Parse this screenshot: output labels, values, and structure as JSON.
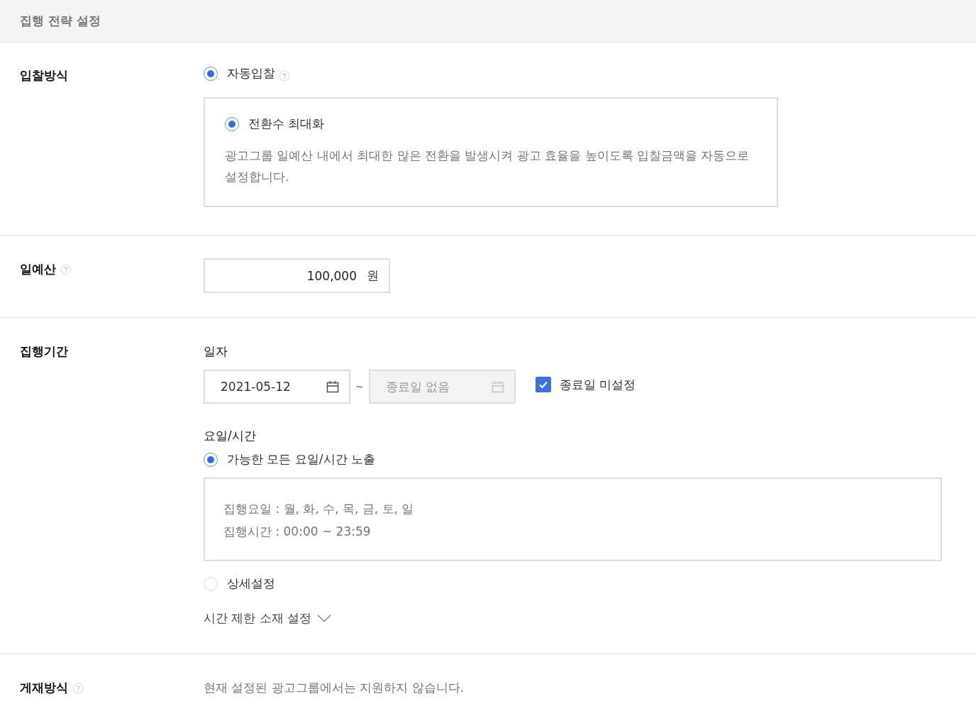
{
  "header": {
    "title": "집행 전략 설정"
  },
  "bidding": {
    "label": "입찰방식",
    "method": {
      "label": "자동입찰",
      "selected": true,
      "help": true
    },
    "option": {
      "label": "전환수 최대화",
      "selected": true,
      "description": "광고그룹 일예산 내에서 최대한 많은 전환을 발생시켜 광고 효율을 높이도록 입찰금액을 자동으로 설정합니다."
    }
  },
  "budget": {
    "label": "일예산",
    "help": true,
    "value": "100,000",
    "unit": "원"
  },
  "period": {
    "label": "집행기간",
    "date_label": "일자",
    "start_date": "2021-05-12",
    "separator": "~",
    "end_date": {
      "placeholder": "종료일 없음",
      "disabled": true
    },
    "no_end_date": {
      "label": "종료일 미설정",
      "checked": true
    },
    "schedule_label": "요일/시간",
    "schedule_options": [
      {
        "label": "가능한 모든 요일/시간 노출",
        "selected": true,
        "details": [
          "집행요일 : 월, 화, 수, 목, 금, 토, 일",
          "집행시간 : 00:00 ~ 23:59"
        ]
      },
      {
        "label": "상세설정",
        "selected": false
      }
    ],
    "time_limit": {
      "label": "시간 제한 소재 설정",
      "expanded": false
    }
  },
  "placement": {
    "label": "게재방식",
    "help": true,
    "message": "현재 설정된 광고그룹에서는 지원하지 않습니다."
  }
}
